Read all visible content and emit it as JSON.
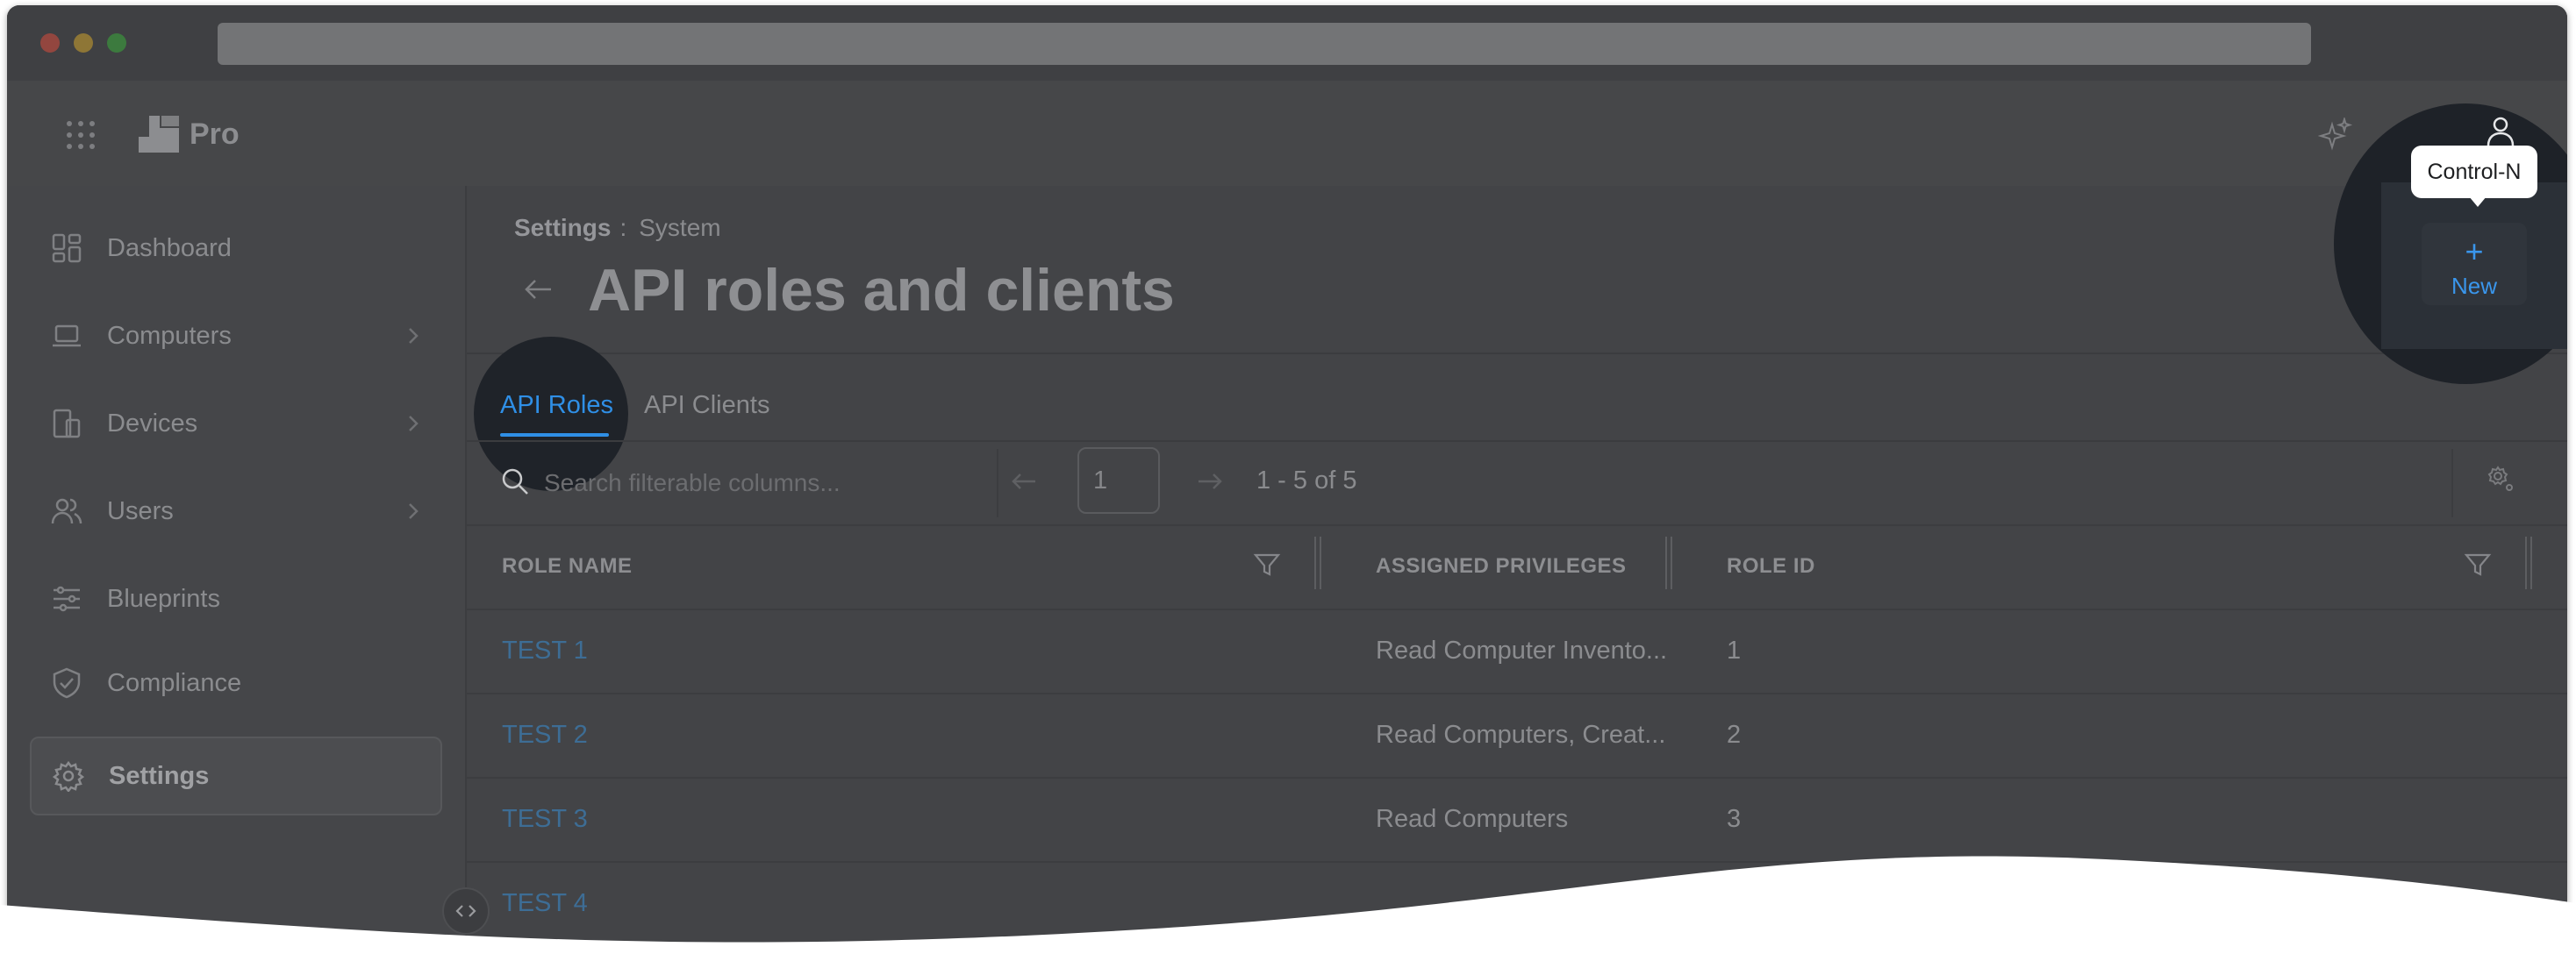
{
  "app": {
    "brand": "Pro"
  },
  "sidebar": {
    "items": [
      {
        "label": "Dashboard",
        "icon": "dashboard-icon",
        "has_chevron": false
      },
      {
        "label": "Computers",
        "icon": "laptop-icon",
        "has_chevron": true
      },
      {
        "label": "Devices",
        "icon": "devices-icon",
        "has_chevron": true
      },
      {
        "label": "Users",
        "icon": "users-icon",
        "has_chevron": true
      },
      {
        "label": "Blueprints",
        "icon": "sliders-icon",
        "has_chevron": false
      },
      {
        "label": "Compliance",
        "icon": "shield-check-icon",
        "has_chevron": false
      },
      {
        "label": "Settings",
        "icon": "gear-icon",
        "has_chevron": false,
        "active": true
      }
    ]
  },
  "breadcrumb": {
    "parent": "Settings",
    "separator": ":",
    "current": "System"
  },
  "page": {
    "title": "API roles and clients"
  },
  "tabs": [
    {
      "label": "API Roles",
      "active": true
    },
    {
      "label": "API Clients",
      "active": false
    }
  ],
  "toolbar": {
    "search_placeholder": "Search filterable columns...",
    "page_number": "1",
    "page_range": "1 - 5 of 5"
  },
  "table": {
    "columns": [
      "ROLE NAME",
      "ASSIGNED PRIVILEGES",
      "ROLE ID"
    ],
    "rows": [
      {
        "name": "TEST 1",
        "privileges": "Read Computer Invento...",
        "id": "1"
      },
      {
        "name": "TEST 2",
        "privileges": "Read Computers, Creat...",
        "id": "2"
      },
      {
        "name": "TEST 3",
        "privileges": "Read Computers",
        "id": "3"
      },
      {
        "name": "TEST 4",
        "privileges": "",
        "id": ""
      }
    ]
  },
  "new_button": {
    "label": "New",
    "tooltip": "Control-N"
  },
  "colors": {
    "accent": "#2f8fe6",
    "link": "#3d6d95",
    "overlay": "#454649"
  }
}
